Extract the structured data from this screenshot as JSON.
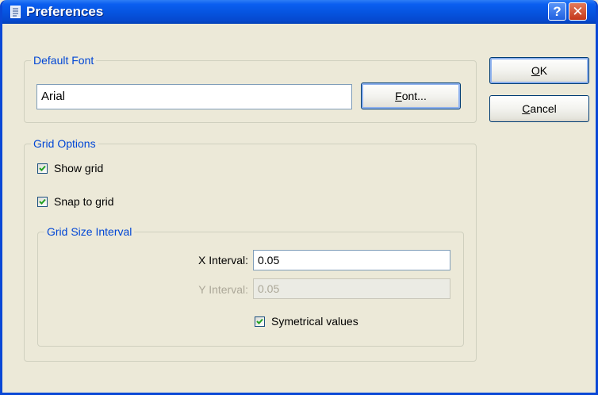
{
  "window": {
    "title": "Preferences",
    "help_label": "?",
    "close_label": "✕"
  },
  "default_font": {
    "legend": "Default Font",
    "value": "Arial",
    "button": {
      "prefix": "",
      "mnemonic": "F",
      "rest": "ont..."
    }
  },
  "grid_options": {
    "legend": "Grid Options",
    "show_grid": {
      "label": "Show grid",
      "checked": true
    },
    "snap_to_grid": {
      "label": "Snap to grid",
      "checked": true
    },
    "interval": {
      "legend": "Grid Size Interval",
      "x_label": "X Interval:",
      "x_value": "0.05",
      "y_label": "Y Interval:",
      "y_value": "0.05",
      "symmetrical": {
        "label": "Symetrical values",
        "checked": true
      }
    }
  },
  "buttons": {
    "ok": {
      "mnemonic": "O",
      "rest": "K"
    },
    "cancel": {
      "mnemonic": "C",
      "rest": "ancel"
    }
  }
}
